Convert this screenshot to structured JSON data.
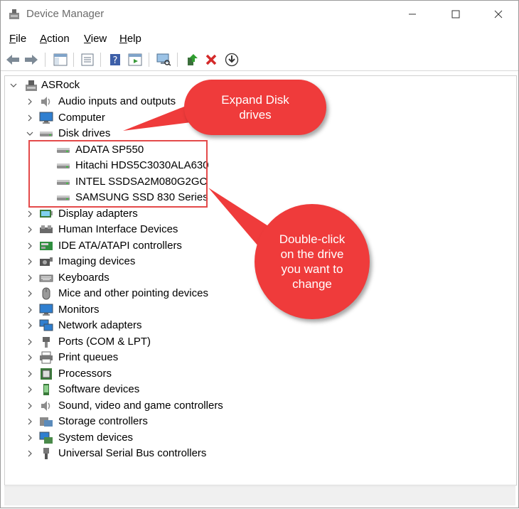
{
  "window": {
    "title": "Device Manager"
  },
  "menu": [
    {
      "label": "File",
      "ul": "F",
      "rest": "ile"
    },
    {
      "label": "Action",
      "ul": "A",
      "rest": "ction"
    },
    {
      "label": "View",
      "ul": "V",
      "rest": "iew"
    },
    {
      "label": "Help",
      "ul": "H",
      "rest": "elp"
    }
  ],
  "toolbar": [
    {
      "icon": "back-arrow-icon"
    },
    {
      "icon": "forward-arrow-icon"
    },
    {
      "icon": "show-hide-console-tree-icon"
    },
    {
      "icon": "properties-icon"
    },
    {
      "icon": "help-icon"
    },
    {
      "icon": "action-pane-icon"
    },
    {
      "icon": "scan-hardware-icon"
    },
    {
      "icon": "update-driver-icon"
    },
    {
      "icon": "uninstall-icon"
    },
    {
      "icon": "download-icon"
    }
  ],
  "tree": {
    "root": "ASRock",
    "categories": [
      {
        "label": "Audio inputs and outputs",
        "icon": "speaker-icon",
        "expanded": false
      },
      {
        "label": "Computer",
        "icon": "monitor-icon",
        "expanded": false
      },
      {
        "label": "Disk drives",
        "icon": "disk-drive-icon",
        "expanded": true,
        "children": [
          "ADATA SP550",
          "Hitachi HDS5C3030ALA630",
          "INTEL SSDSA2M080G2GC",
          "SAMSUNG SSD 830 Series"
        ]
      },
      {
        "label": "Display adapters",
        "icon": "display-adapter-icon",
        "expanded": false
      },
      {
        "label": "Human Interface Devices",
        "icon": "hid-icon",
        "expanded": false
      },
      {
        "label": "IDE ATA/ATAPI controllers",
        "icon": "ide-controller-icon",
        "expanded": false
      },
      {
        "label": "Imaging devices",
        "icon": "camera-icon",
        "expanded": false
      },
      {
        "label": "Keyboards",
        "icon": "keyboard-icon",
        "expanded": false
      },
      {
        "label": "Mice and other pointing devices",
        "icon": "mouse-icon",
        "expanded": false
      },
      {
        "label": "Monitors",
        "icon": "monitor-icon",
        "expanded": false
      },
      {
        "label": "Network adapters",
        "icon": "network-icon",
        "expanded": false
      },
      {
        "label": "Ports (COM & LPT)",
        "icon": "port-icon",
        "expanded": false
      },
      {
        "label": "Print queues",
        "icon": "printer-icon",
        "expanded": false
      },
      {
        "label": "Processors",
        "icon": "processor-icon",
        "expanded": false
      },
      {
        "label": "Software devices",
        "icon": "software-device-icon",
        "expanded": false
      },
      {
        "label": "Sound, video and game controllers",
        "icon": "speaker-icon",
        "expanded": false
      },
      {
        "label": "Storage controllers",
        "icon": "storage-controller-icon",
        "expanded": false
      },
      {
        "label": "System devices",
        "icon": "system-device-icon",
        "expanded": false
      },
      {
        "label": "Universal Serial Bus controllers",
        "icon": "usb-icon",
        "expanded": false
      }
    ]
  },
  "annotations": {
    "expand_note": "Expand Disk drives",
    "doubleclick_note": "Double-click on the drive you want to change",
    "color": "#ef3b3b"
  }
}
